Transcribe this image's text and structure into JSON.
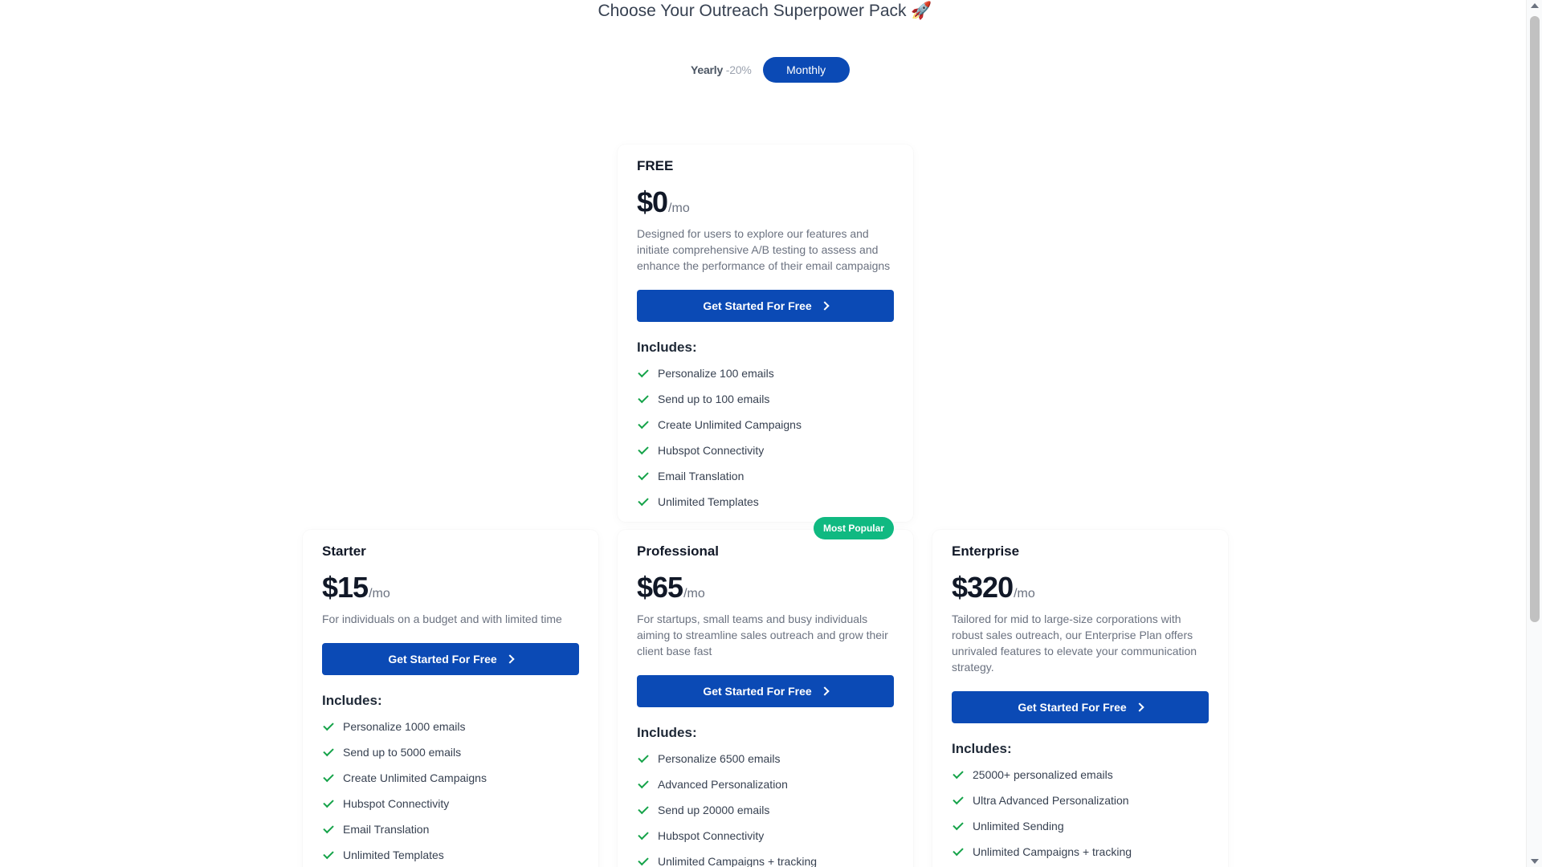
{
  "header": {
    "title": "Choose Your Outreach Superpower Pack",
    "title_emoji": "🚀"
  },
  "billing_toggle": {
    "yearly_label": "Yearly",
    "yearly_discount": "-20%",
    "monthly_label": "Monthly",
    "selected": "Monthly"
  },
  "plans": {
    "free": {
      "name": "FREE",
      "price": "$0",
      "per": "/mo",
      "description": "Designed for users to explore our features and initiate comprehensive A/B testing to assess and enhance the performance of their email campaigns",
      "cta": "Get Started For Free",
      "includes_label": "Includes:",
      "features": [
        "Personalize 100 emails",
        "Send up to 100 emails",
        "Create Unlimited Campaigns",
        "Hubspot Connectivity",
        "Email Translation",
        "Unlimited Templates"
      ]
    },
    "starter": {
      "name": "Starter",
      "price": "$15",
      "per": "/mo",
      "description": "For individuals on a budget and with limited time",
      "cta": "Get Started For Free",
      "includes_label": "Includes:",
      "features": [
        "Personalize 1000 emails",
        "Send up to 5000 emails",
        "Create Unlimited Campaigns",
        "Hubspot Connectivity",
        "Email Translation",
        "Unlimited Templates"
      ]
    },
    "professional": {
      "badge": "Most Popular",
      "name": "Professional",
      "price": "$65",
      "per": "/mo",
      "description": "For startups, small teams and busy individuals aiming to streamline sales outreach and grow their client base fast",
      "cta": "Get Started For Free",
      "includes_label": "Includes:",
      "features": [
        "Personalize 6500 emails",
        "Advanced Personalization",
        "Send up 20000 emails",
        "Hubspot Connectivity",
        "Unlimited Campaigns + tracking"
      ]
    },
    "enterprise": {
      "name": "Enterprise",
      "price": "$320",
      "per": "/mo",
      "description": "Tailored for mid to large-size corporations with robust sales outreach, our Enterprise Plan offers unrivaled features to elevate your communication strategy.",
      "cta": "Get Started For Free",
      "includes_label": "Includes:",
      "features": [
        "25000+ personalized emails",
        "Ultra Advanced Personalization",
        "Unlimited Sending",
        "Unlimited Campaigns + tracking"
      ]
    }
  },
  "colors": {
    "primary": "#0b4ab5",
    "badge": "#10b981",
    "check": "#16a34a"
  }
}
